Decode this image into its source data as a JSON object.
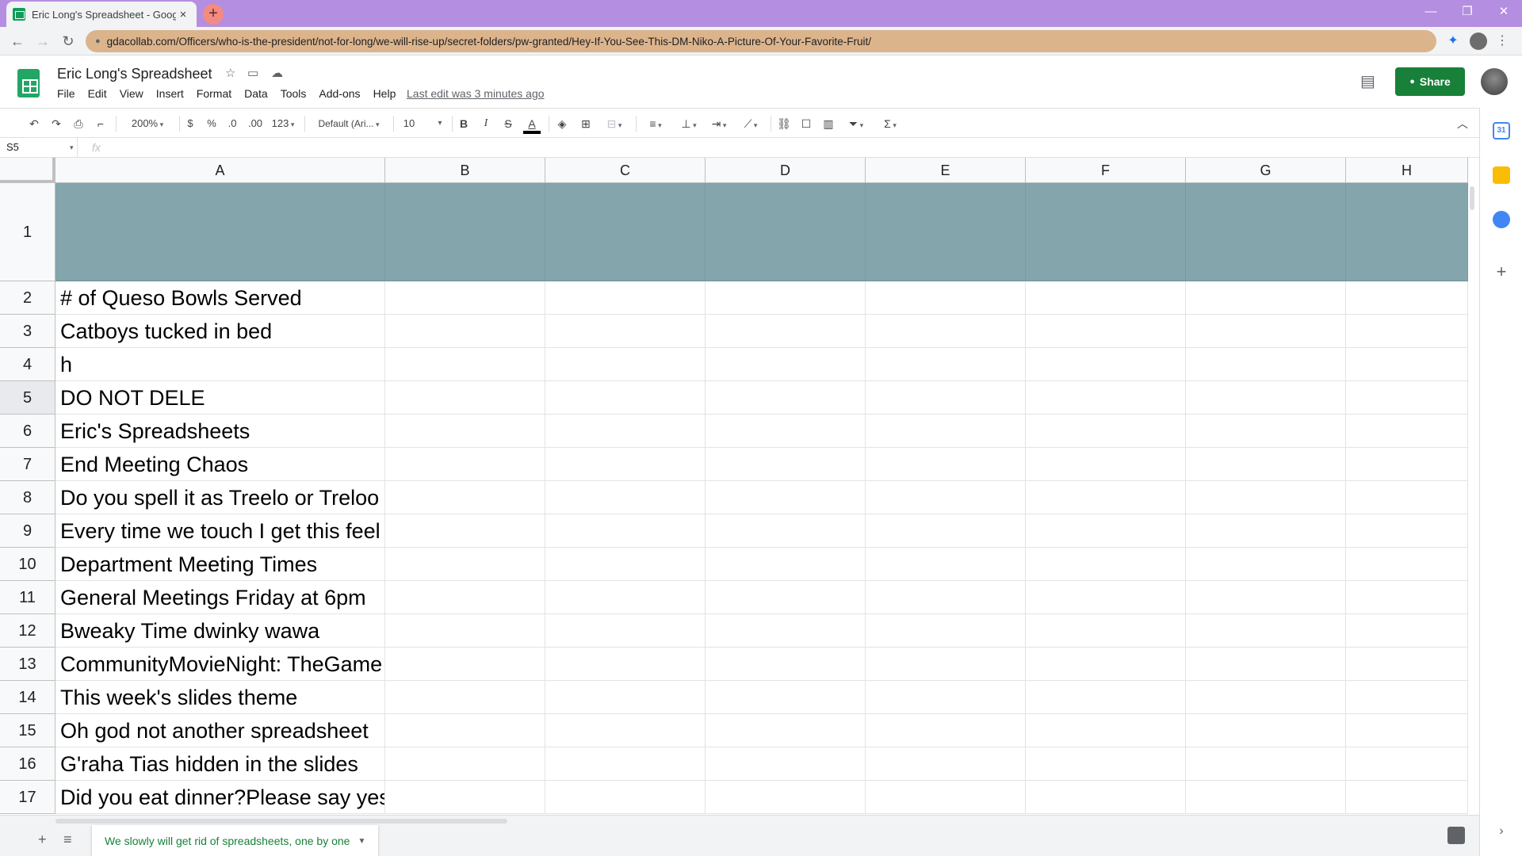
{
  "browser": {
    "tab_title": "Eric Long's Spreadsheet - Google",
    "tab_close": "×",
    "new_tab": "+",
    "url": "gdacollab.com/Officers/who-is-the-president/not-for-long/we-will-rise-up/secret-folders/pw-granted/Hey-If-You-See-This-DM-Niko-A-Picture-Of-Your-Favorite-Fruit/",
    "window_controls": {
      "minimize": "—",
      "maximize": "❐",
      "close": "✕"
    },
    "accent_color": "#b48ee0",
    "url_bg_color": "#dcb48c"
  },
  "doc": {
    "title": "Eric Long's Spreadsheet",
    "menu": [
      "File",
      "Edit",
      "View",
      "Insert",
      "Format",
      "Data",
      "Tools",
      "Add-ons",
      "Help"
    ],
    "last_edit": "Last edit was 3 minutes ago",
    "share_label": "Share"
  },
  "toolbar": {
    "zoom": "200%",
    "currency": "$",
    "percent": "%",
    "decrease_decimal": ".0",
    "increase_decimal": ".00",
    "more_formats": "123",
    "font": "Default (Ari...",
    "font_size": "10",
    "bold": "B",
    "italic": "I",
    "strikethrough": "S",
    "text_color": "A"
  },
  "formula_bar": {
    "cell_ref": "S5",
    "fx": "fx",
    "value": ""
  },
  "grid": {
    "columns": [
      "A",
      "B",
      "C",
      "D",
      "E",
      "F",
      "G",
      "H"
    ],
    "header_fill_color": "#84a5ab",
    "selected_row": 5,
    "rows": [
      {
        "n": "1",
        "a": ""
      },
      {
        "n": "2",
        "a": "# of Queso Bowls Served"
      },
      {
        "n": "3",
        "a": "Catboys tucked in bed"
      },
      {
        "n": "4",
        "a": "h"
      },
      {
        "n": "5",
        "a": "DO NOT DELE"
      },
      {
        "n": "6",
        "a": "Eric's Spreadsheets"
      },
      {
        "n": "7",
        "a": "End Meeting Chaos"
      },
      {
        "n": "8",
        "a": "Do you spell it as Treelo or Treloo"
      },
      {
        "n": "9",
        "a": "Every time we touch I get this feel"
      },
      {
        "n": "10",
        "a": "Department Meeting Times"
      },
      {
        "n": "11",
        "a": "General Meetings Friday at 6pm"
      },
      {
        "n": "12",
        "a": "Bweaky Time dwinky wawa"
      },
      {
        "n": "13",
        "a": "CommunityMovieNight: TheGame"
      },
      {
        "n": "14",
        "a": "This week's slides theme"
      },
      {
        "n": "15",
        "a": "Oh god not another spreadsheet"
      },
      {
        "n": "16",
        "a": "G'raha Tias hidden in the slides"
      },
      {
        "n": "17",
        "a": "Did you eat dinner?Please say yes"
      }
    ]
  },
  "sheet_tabs": {
    "active": "We slowly will get rid of spreadsheets, one by one"
  }
}
